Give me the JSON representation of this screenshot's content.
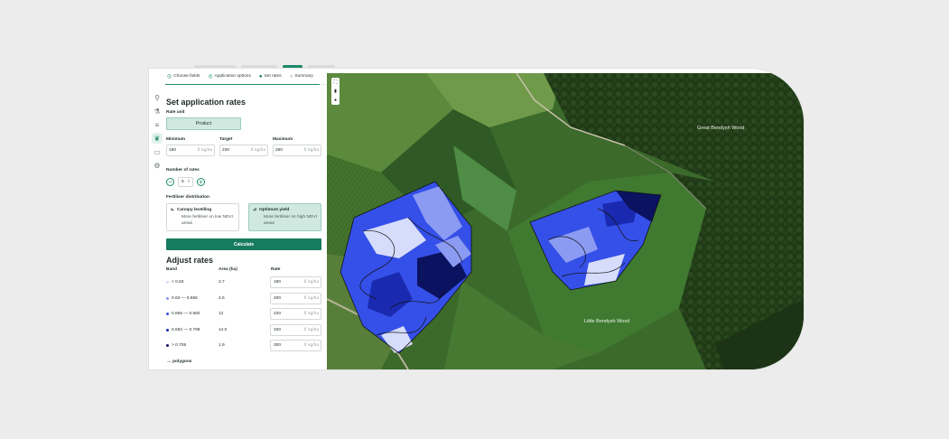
{
  "steps": [
    {
      "label": "Choose fields",
      "icon": "check-circle-icon"
    },
    {
      "label": "Application options",
      "icon": "check-circle-icon"
    },
    {
      "label": "Set rates",
      "icon": "current-step-icon"
    },
    {
      "label": "Summary",
      "icon": "empty-circle-icon"
    }
  ],
  "title": "Set application rates",
  "rate_unit": {
    "label": "Rate unit",
    "value": "Product"
  },
  "range": {
    "min": {
      "label": "Minimum",
      "value": "180",
      "unit": "kg/ha"
    },
    "target": {
      "label": "Target",
      "value": "230",
      "unit": "kg/ha"
    },
    "max": {
      "label": "Maximum",
      "value": "260",
      "unit": "kg/ha"
    }
  },
  "num_rates": {
    "label": "Number of rates",
    "value": "5",
    "minus": "−",
    "plus": "+"
  },
  "distribution": {
    "label": "Fertiliser distribution",
    "options": [
      {
        "title": "Canopy levelling",
        "desc": "More fertiliser on low NDVI areas",
        "selected": false
      },
      {
        "title": "Optimum yield",
        "desc": "More fertiliser on high NDVI areas",
        "selected": true
      }
    ]
  },
  "calculate_label": "Calculate",
  "adjust": {
    "title": "Adjust rates",
    "headers": {
      "band": "Band",
      "area": "Area (ha)",
      "rate": "Rate"
    },
    "rows": [
      {
        "band": "< 0.63",
        "area": "3.7",
        "rate": "180",
        "unit": "kg/ha",
        "color": "#d6dcfb"
      },
      {
        "band": "0.63 — 0.656",
        "area": "4.5",
        "rate": "200",
        "unit": "kg/ha",
        "color": "#8c9bf2"
      },
      {
        "band": "0.656 — 0.682",
        "area": "12",
        "rate": "220",
        "unit": "kg/ha",
        "color": "#3550e8"
      },
      {
        "band": "0.682 — 0.708",
        "area": "14.0",
        "rate": "330",
        "unit": "kg/ha",
        "color": "#1a2ab0"
      },
      {
        "band": "> 0.708",
        "area": "1.9",
        "rate": "300",
        "unit": "kg/ha",
        "color": "#0b1260"
      }
    ]
  },
  "footer_label": "… polygons",
  "map": {
    "labels": {
      "great_wood": "Great Bendysh Wood",
      "little_wood": "Little Bendysh Wood"
    }
  },
  "colors": {
    "accent": "#177b5f",
    "selected_bg": "#cfe9e0"
  }
}
